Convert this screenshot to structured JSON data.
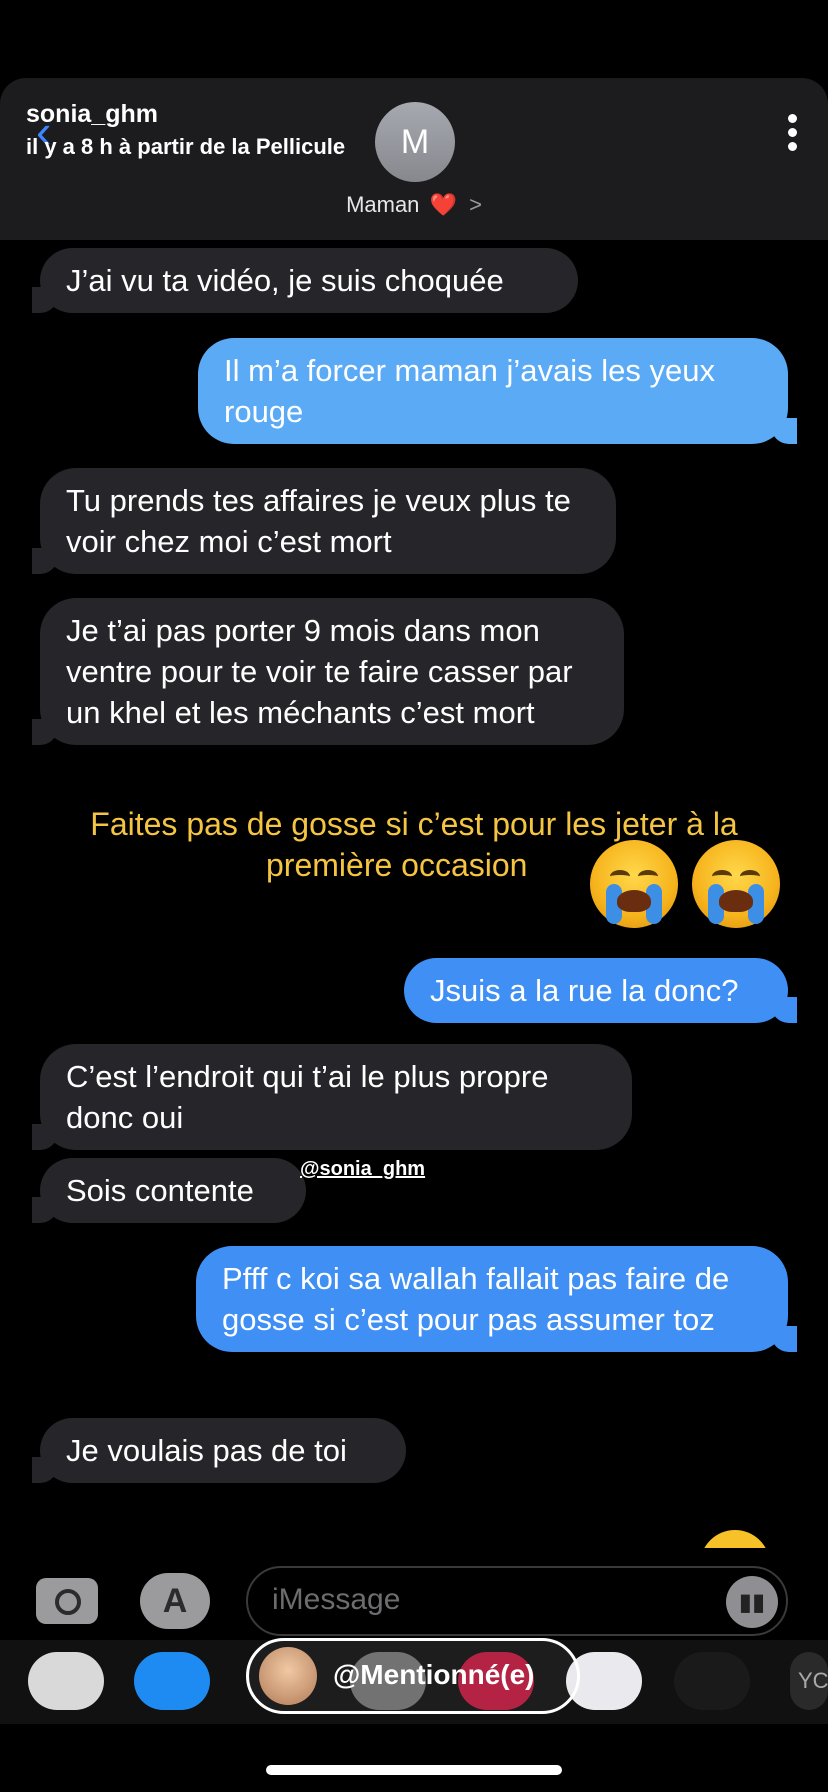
{
  "story": {
    "username": "sonia_ghm",
    "meta": "il y a 8 h à partir de la Pellicule"
  },
  "header": {
    "avatar_initial": "M",
    "contact_name": "Maman",
    "heart": "❤️",
    "chevron": ">"
  },
  "messages": [
    {
      "dir": "in",
      "text": "J’ai vu ta vidéo, je suis choquée"
    },
    {
      "dir": "out",
      "text": "Il m’a forcer maman j’avais les yeux rouge"
    },
    {
      "dir": "in",
      "text": "Tu prends tes affaires je veux plus te voir chez moi c’est mort"
    },
    {
      "dir": "in",
      "text": "Je t’ai pas porter 9 mois dans mon ventre pour te voir te faire casser par un khel et les méchants c’est mort"
    },
    {
      "dir": "out",
      "text": "Jsuis a la rue la donc?"
    },
    {
      "dir": "in",
      "text": "C’est l’endroit qui t’ai le plus propre donc oui"
    },
    {
      "dir": "in",
      "text": "Sois contente"
    },
    {
      "dir": "out",
      "text": "Pfff c koi sa wallah fallait pas faire de gosse si c’est pour pas assumer toz"
    },
    {
      "dir": "in",
      "text": "Je voulais pas de toi"
    }
  ],
  "caption": {
    "line1": "Faites pas de gosse si c’est pour les jeter à la",
    "line2": "première occasion",
    "emoji": "loudly-crying-face"
  },
  "mention_tag": "@sonia_ghm",
  "compose": {
    "placeholder": "iMessage",
    "caret": "︿"
  },
  "tray": {
    "mention_label": "@Mentionné(e)",
    "icons": [
      "photos-icon",
      "app-store-icon",
      "memoji-icon",
      "search-icon",
      "music-icon",
      "heart-app-icon"
    ],
    "partial_label": "YC"
  },
  "colors": {
    "incoming": "#26252a",
    "outgoing": "#3f8ff5",
    "caption": "#f5c542"
  }
}
